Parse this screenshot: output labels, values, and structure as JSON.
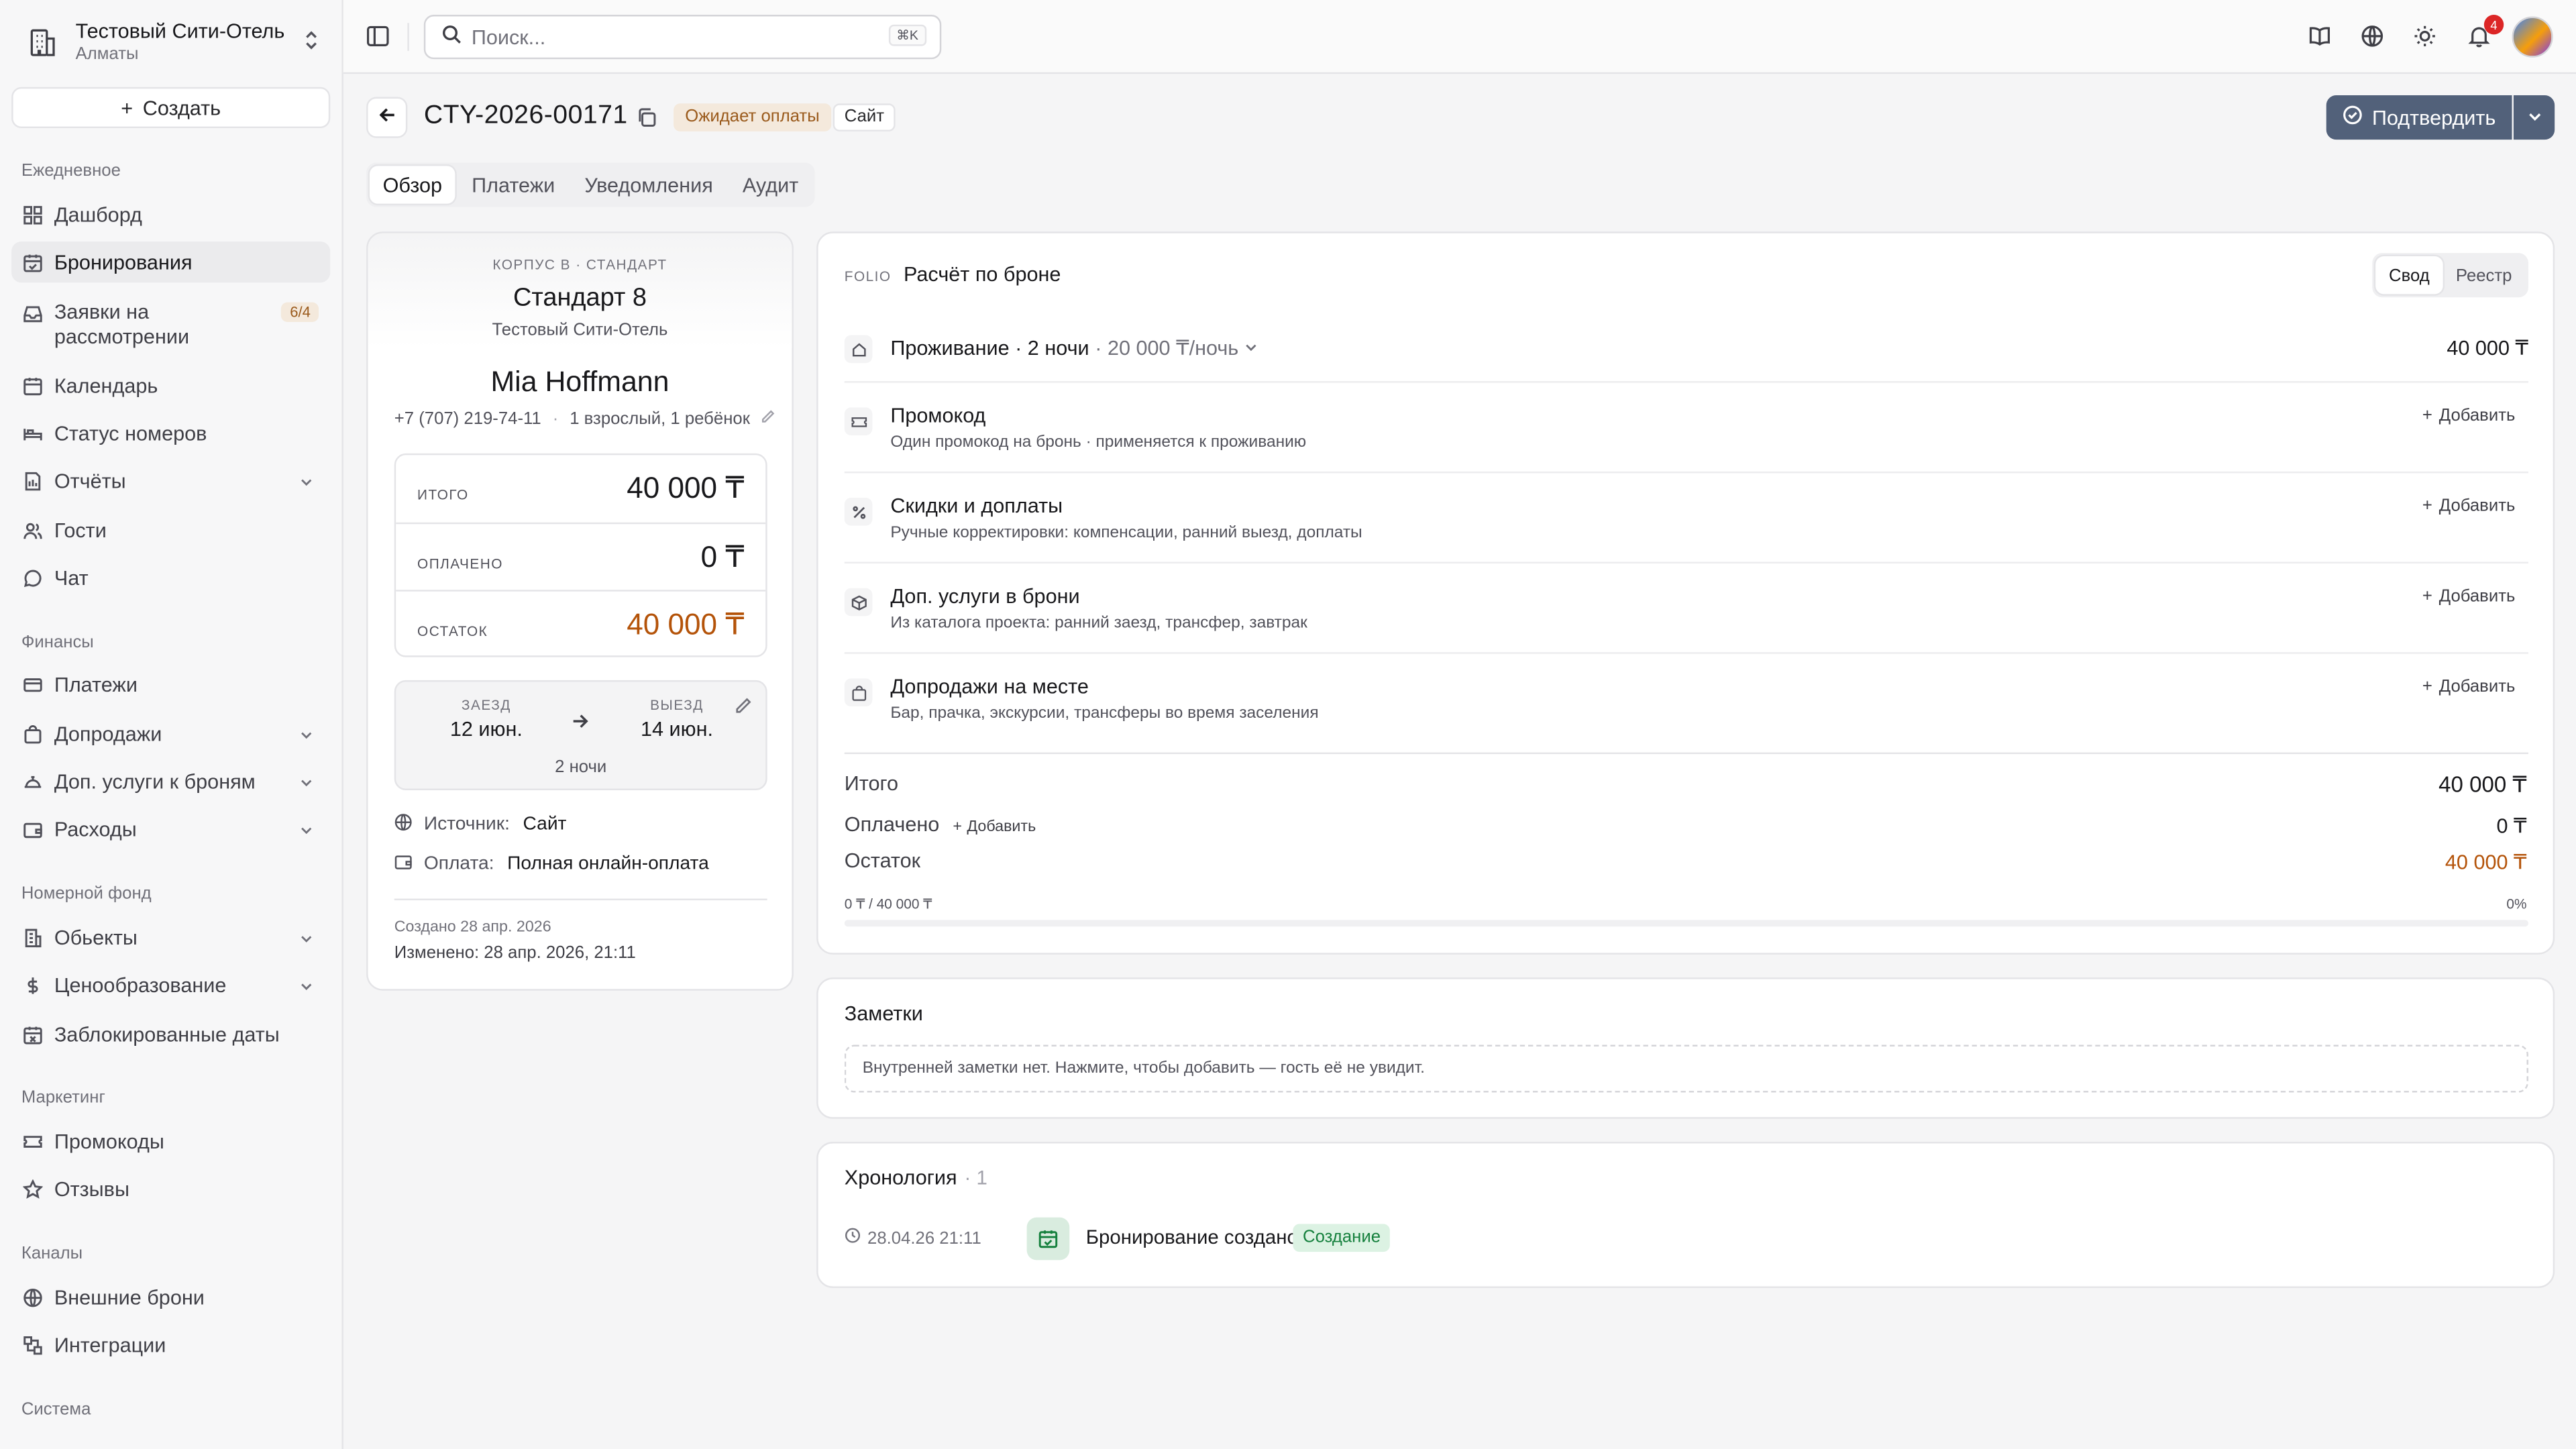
{
  "sidebar": {
    "hotel_name": "Тестовый Сити-Отель",
    "hotel_city": "Алматы",
    "create_label": "Создать",
    "sections": [
      "Ежедневное",
      "Финансы",
      "Номерной фонд",
      "Маркетинг",
      "Каналы",
      "Система"
    ],
    "items": [
      {
        "label": "Дашборд",
        "icon": "dashboard-icon"
      },
      {
        "label": "Бронирования",
        "icon": "calendar-check-icon",
        "active": true
      },
      {
        "label": "Заявки на рассмотрении",
        "icon": "inbox-icon",
        "badge": "6/4"
      },
      {
        "label": "Календарь",
        "icon": "calendar-icon"
      },
      {
        "label": "Статус номеров",
        "icon": "bed-icon"
      },
      {
        "label": "Отчёты",
        "icon": "report-icon",
        "expandable": true
      },
      {
        "label": "Гости",
        "icon": "users-icon"
      },
      {
        "label": "Чат",
        "icon": "chat-icon"
      },
      {
        "label": "Платежи",
        "icon": "card-icon"
      },
      {
        "label": "Допродажи",
        "icon": "bag-icon",
        "expandable": true
      },
      {
        "label": "Доп. услуги к броням",
        "icon": "service-icon",
        "expandable": true
      },
      {
        "label": "Расходы",
        "icon": "wallet-icon",
        "expandable": true
      },
      {
        "label": "Обьекты",
        "icon": "building-icon",
        "expandable": true
      },
      {
        "label": "Ценообразование",
        "icon": "dollar-icon",
        "expandable": true
      },
      {
        "label": "Заблокированные даты",
        "icon": "calendar-x-icon"
      },
      {
        "label": "Промокоды",
        "icon": "ticket-icon"
      },
      {
        "label": "Отзывы",
        "icon": "star-icon"
      },
      {
        "label": "Внешние брони",
        "icon": "globe-icon"
      },
      {
        "label": "Интеграции",
        "icon": "plug-icon"
      }
    ]
  },
  "topbar": {
    "search_placeholder": "Поиск...",
    "search_shortcut": "⌘K",
    "notification_count": "4"
  },
  "header": {
    "booking_id": "CTY-2026-00171",
    "status": "Ожидает оплаты",
    "source": "Сайт",
    "confirm_label": "Подтвердить",
    "tabs": [
      "Обзор",
      "Платежи",
      "Уведомления",
      "Аудит"
    ]
  },
  "booking_card": {
    "room_type": "КОРПУС B · СТАНДАРТ",
    "room_name": "Стандарт 8",
    "hotel": "Тестовый Сити-Отель",
    "guest_name": "Mia Hoffmann",
    "phone": "+7 (707) 219-74-11",
    "guests": "1 взрослый, 1 ребёнок",
    "total_label": "ИТОГО",
    "total_value": "40 000 ₸",
    "paid_label": "ОПЛАЧЕНО",
    "paid_value": "0 ₸",
    "balance_label": "ОСТАТОК",
    "balance_value": "40 000 ₸",
    "checkin_label": "ЗАЕЗД",
    "checkin_date": "12 июн.",
    "checkout_label": "ВЫЕЗД",
    "checkout_date": "14 июн.",
    "nights": "2 ночи",
    "source_label": "Источник:",
    "source_value": "Сайт",
    "payment_label": "Оплата:",
    "payment_value": "Полная онлайн-оплата",
    "created": "Создано 28 апр. 2026",
    "modified": "Изменено: 28 апр. 2026, 21:11"
  },
  "folio": {
    "tag": "FOLIO",
    "title": "Расчёт по броне",
    "view_summary": "Свод",
    "view_register": "Реестр",
    "stay_title": "Проживание · 2 ночи",
    "stay_rate": "20 000 ₸/ночь",
    "stay_amount": "40 000 ₸",
    "add_label": "Добавить",
    "rows": [
      {
        "title": "Промокод",
        "sub": "Один промокод на бронь · применяется к проживанию",
        "icon": "ticket-icon"
      },
      {
        "title": "Скидки и доплаты",
        "sub": "Ручные корректировки: компенсации, ранний выезд, доплаты",
        "icon": "percent-icon"
      },
      {
        "title": "Доп. услуги в брони",
        "sub": "Из каталога проекта: ранний заезд, трансфер, завтрак",
        "icon": "package-icon"
      },
      {
        "title": "Допродажи на месте",
        "sub": "Бар, прачка, экскурсии, трансферы во время заселения",
        "icon": "bag-icon"
      }
    ],
    "total_label": "Итого",
    "total_value": "40 000 ₸",
    "paid_label": "Оплачено",
    "paid_value": "0 ₸",
    "balance_label": "Остаток",
    "balance_value": "40 000 ₸",
    "progress_text": "0 ₸ / 40 000 ₸",
    "progress_percent_text": "0%",
    "progress_fraction": 0
  },
  "notes": {
    "title": "Заметки",
    "placeholder": "Внутренней заметки нет. Нажмите, чтобы добавить — гость её не увидит."
  },
  "timeline": {
    "title": "Хронология",
    "count": "· 1",
    "events": [
      {
        "time": "28.04.26 21:11",
        "text": "Бронирование создано",
        "badge": "Создание"
      }
    ]
  },
  "colors": {
    "accent": "#52617a",
    "warning": "#b45309",
    "success": "#15803d"
  }
}
